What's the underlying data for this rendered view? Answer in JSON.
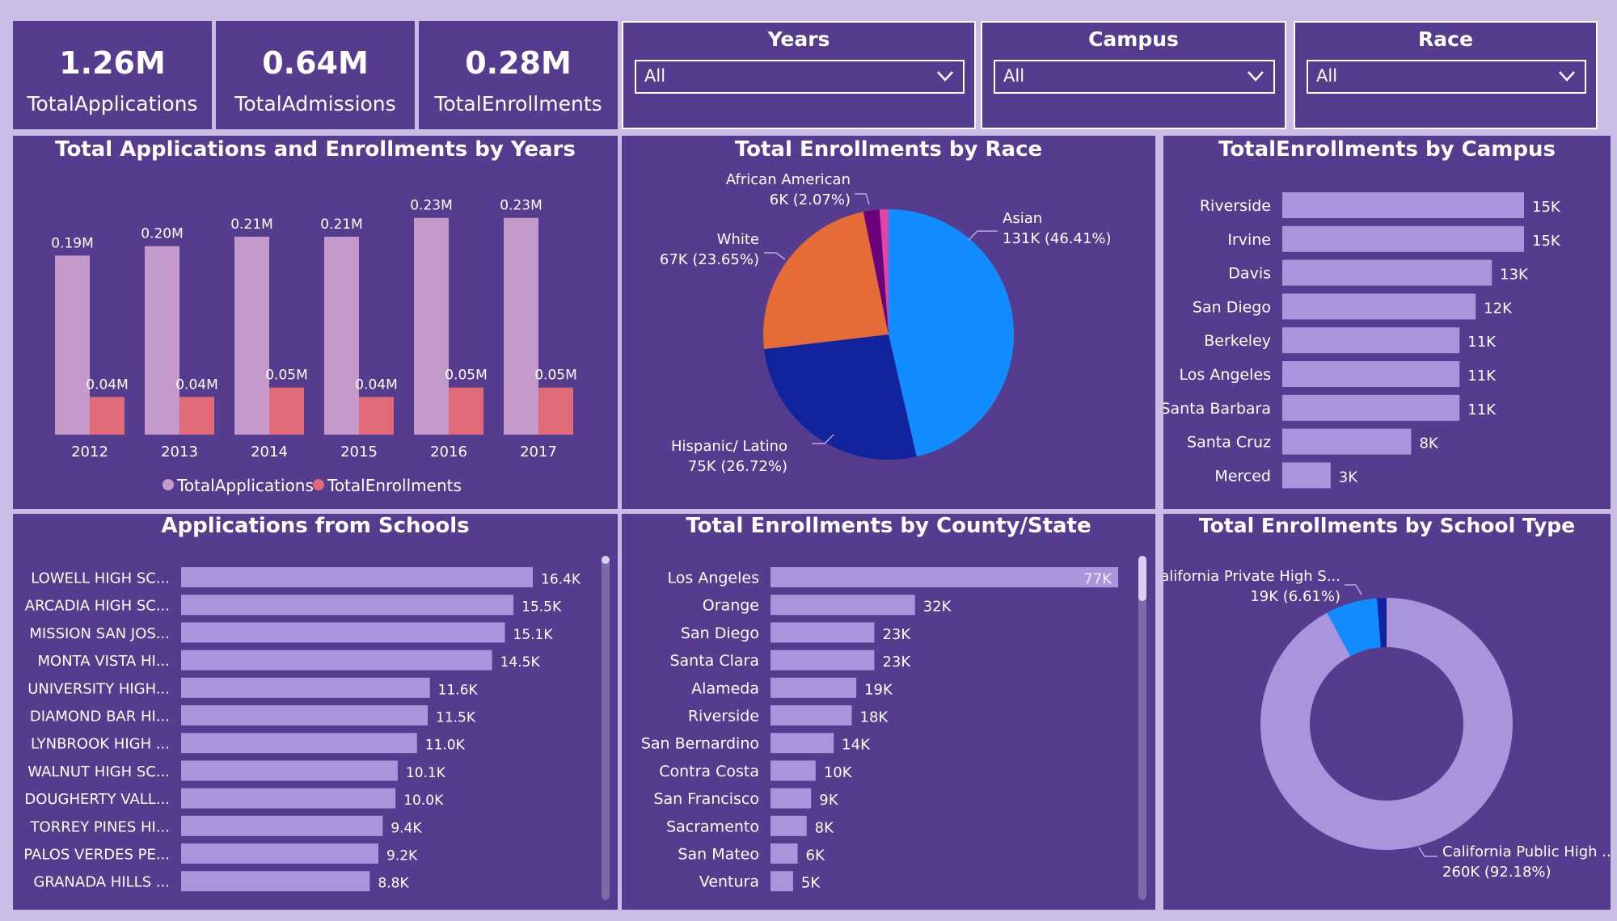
{
  "colors": {
    "panel": "#563c8e",
    "bar_light": "#a995dc",
    "app_bar": "#c39ac9",
    "enroll_bar": "#e06a78",
    "asian": "#118dff",
    "hispanic": "#12239e",
    "white": "#e66c37",
    "african": "#6b007b",
    "other": "#e044a7",
    "public": "#a995dc",
    "private": "#118dff",
    "other_type": "#12239e"
  },
  "kpis": [
    {
      "value": "1.26M",
      "label": "TotalApplications"
    },
    {
      "value": "0.64M",
      "label": "TotalAdmissions"
    },
    {
      "value": "0.28M",
      "label": "TotalEnrollments"
    }
  ],
  "filters": [
    {
      "title": "Years",
      "value": "All"
    },
    {
      "title": "Campus",
      "value": "All"
    },
    {
      "title": "Race",
      "value": "All"
    }
  ],
  "chart_data": [
    {
      "id": "years",
      "type": "bar",
      "title": "Total Applications and Enrollments by Years",
      "categories": [
        "2012",
        "2013",
        "2014",
        "2015",
        "2016",
        "2017"
      ],
      "series": [
        {
          "name": "TotalApplications",
          "values": [
            0.19,
            0.2,
            0.21,
            0.21,
            0.23,
            0.23
          ],
          "labels": [
            "0.19M",
            "0.20M",
            "0.21M",
            "0.21M",
            "0.23M",
            "0.23M"
          ]
        },
        {
          "name": "TotalEnrollments",
          "values": [
            0.04,
            0.04,
            0.05,
            0.04,
            0.05,
            0.05
          ],
          "labels": [
            "0.04M",
            "0.04M",
            "0.05M",
            "0.04M",
            "0.05M",
            "0.05M"
          ]
        }
      ],
      "ylim": [
        0,
        0.24
      ],
      "legend": "bottom-center"
    },
    {
      "id": "race",
      "type": "pie",
      "title": "Total Enrollments by Race",
      "slices": [
        {
          "name": "Asian",
          "value": 46.41,
          "label": "131K (46.41%)"
        },
        {
          "name": "Hispanic/ Latino",
          "value": 26.72,
          "label": "75K (26.72%)"
        },
        {
          "name": "White",
          "value": 23.65,
          "label": "67K (23.65%)"
        },
        {
          "name": "African American",
          "value": 2.07,
          "label": "6K (2.07%)"
        },
        {
          "name": "",
          "value": 1.15,
          "label": ""
        }
      ]
    },
    {
      "id": "campus",
      "type": "bar",
      "orientation": "horizontal",
      "title": "TotalEnrollments by Campus",
      "categories": [
        "Riverside",
        "Irvine",
        "Davis",
        "San Diego",
        "Berkeley",
        "Los Angeles",
        "Santa Barbara",
        "Santa Cruz",
        "Merced"
      ],
      "values": [
        15,
        15,
        13,
        12,
        11,
        11,
        11,
        8,
        3
      ],
      "labels": [
        "15K",
        "15K",
        "13K",
        "12K",
        "11K",
        "11K",
        "11K",
        "8K",
        "3K"
      ],
      "xlim": [
        0,
        15.3
      ]
    },
    {
      "id": "schools",
      "type": "bar",
      "orientation": "horizontal",
      "title": "Applications from Schools",
      "categories": [
        "LOWELL HIGH SC...",
        "ARCADIA HIGH SC...",
        "MISSION SAN JOS...",
        "MONTA VISTA HI...",
        "UNIVERSITY HIGH...",
        "DIAMOND BAR HI...",
        "LYNBROOK HIGH ...",
        "WALNUT HIGH SC...",
        "DOUGHERTY VALL...",
        "TORREY PINES HI...",
        "PALOS VERDES PE...",
        "GRANADA HILLS ..."
      ],
      "values": [
        16.4,
        15.5,
        15.1,
        14.5,
        11.6,
        11.5,
        11.0,
        10.1,
        10.0,
        9.4,
        9.2,
        8.8
      ],
      "labels": [
        "16.4K",
        "15.5K",
        "15.1K",
        "14.5K",
        "11.6K",
        "11.5K",
        "11.0K",
        "10.1K",
        "10.0K",
        "9.4K",
        "9.2K",
        "8.8K"
      ],
      "xlim": [
        0,
        16.4
      ]
    },
    {
      "id": "county",
      "type": "bar",
      "orientation": "horizontal",
      "title": "Total Enrollments by County/State",
      "categories": [
        "Los Angeles",
        "Orange",
        "San Diego",
        "Santa Clara",
        "Alameda",
        "Riverside",
        "San Bernardino",
        "Contra Costa",
        "San Francisco",
        "Sacramento",
        "San Mateo",
        "Ventura"
      ],
      "values": [
        77,
        32,
        23,
        23,
        19,
        18,
        14,
        10,
        9,
        8,
        6,
        5
      ],
      "labels": [
        "77K",
        "32K",
        "23K",
        "23K",
        "19K",
        "18K",
        "14K",
        "10K",
        "9K",
        "8K",
        "6K",
        "5K"
      ],
      "xlim": [
        0,
        77
      ]
    },
    {
      "id": "schooltype",
      "type": "pie",
      "variant": "donut",
      "title": "Total Enrollments by School Type",
      "slices": [
        {
          "name": "California Public High ...",
          "value": 92.18,
          "label": "260K (92.18%)"
        },
        {
          "name": "California Private High S...",
          "value": 6.61,
          "label": "19K (6.61%)"
        },
        {
          "name": "",
          "value": 1.21,
          "label": ""
        }
      ]
    }
  ]
}
